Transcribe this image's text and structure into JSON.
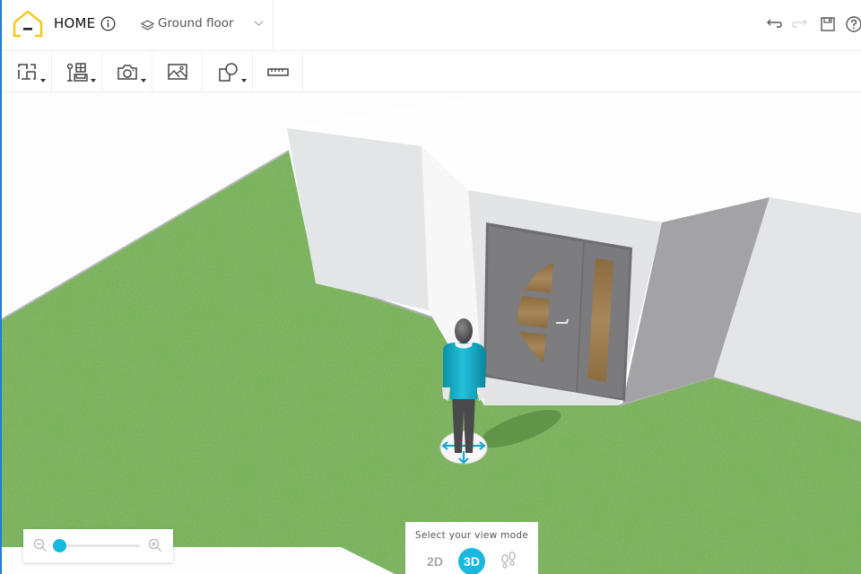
{
  "header": {
    "project_name": "HOME",
    "floor_selector": {
      "selected": "Ground floor"
    },
    "actions": [
      {
        "name": "undo",
        "enabled": true
      },
      {
        "name": "redo",
        "enabled": false
      },
      {
        "name": "save",
        "enabled": true
      },
      {
        "name": "help",
        "enabled": true
      }
    ]
  },
  "toolbar": {
    "tools": [
      {
        "id": "floor-plan",
        "icon": "floor-plan-icon",
        "has_dropdown": true
      },
      {
        "id": "furniture",
        "icon": "furniture-icon",
        "has_dropdown": true
      },
      {
        "id": "camera",
        "icon": "camera-icon",
        "has_dropdown": true
      },
      {
        "id": "gallery",
        "icon": "image-icon",
        "has_dropdown": false
      },
      {
        "id": "shapes",
        "icon": "shapes-icon",
        "has_dropdown": true
      },
      {
        "id": "measure",
        "icon": "ruler-icon",
        "has_dropdown": false
      }
    ]
  },
  "zoom": {
    "level_fraction": 0.0
  },
  "view_mode": {
    "title": "Select your view mode",
    "options": [
      {
        "label": "2D",
        "active": false
      },
      {
        "label": "3D",
        "active": true
      },
      {
        "label": "walk",
        "active": false
      }
    ]
  },
  "colors": {
    "accent": "#19b8e0",
    "logo": "#f5c518",
    "grass": "#6aa84f",
    "door": "#7b7a7c"
  }
}
